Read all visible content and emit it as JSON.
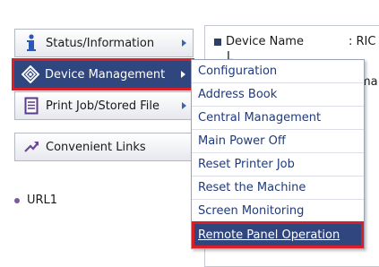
{
  "nav": {
    "status_label": "Status/Information",
    "device_label": "Device Management",
    "print_label": "Print Job/Stored File",
    "links_label": "Convenient Links"
  },
  "url": {
    "label": "URL1"
  },
  "info": {
    "device_name_label": "Device Name",
    "device_name_value": ": RIC",
    "clipped_label_partial": "L",
    "clipped_value_partial": "ma"
  },
  "submenu": {
    "items": [
      "Configuration",
      "Address Book",
      "Central Management",
      "Main Power Off",
      "Reset Printer Job",
      "Reset the Machine",
      "Screen Monitoring",
      "Remote Panel Operation"
    ],
    "active_index": 7
  },
  "colors": {
    "nav_selected_bg": "#2f467e",
    "highlight_border": "#d81e26",
    "link_text": "#203a7a",
    "bullet": "#7a5a9e"
  }
}
